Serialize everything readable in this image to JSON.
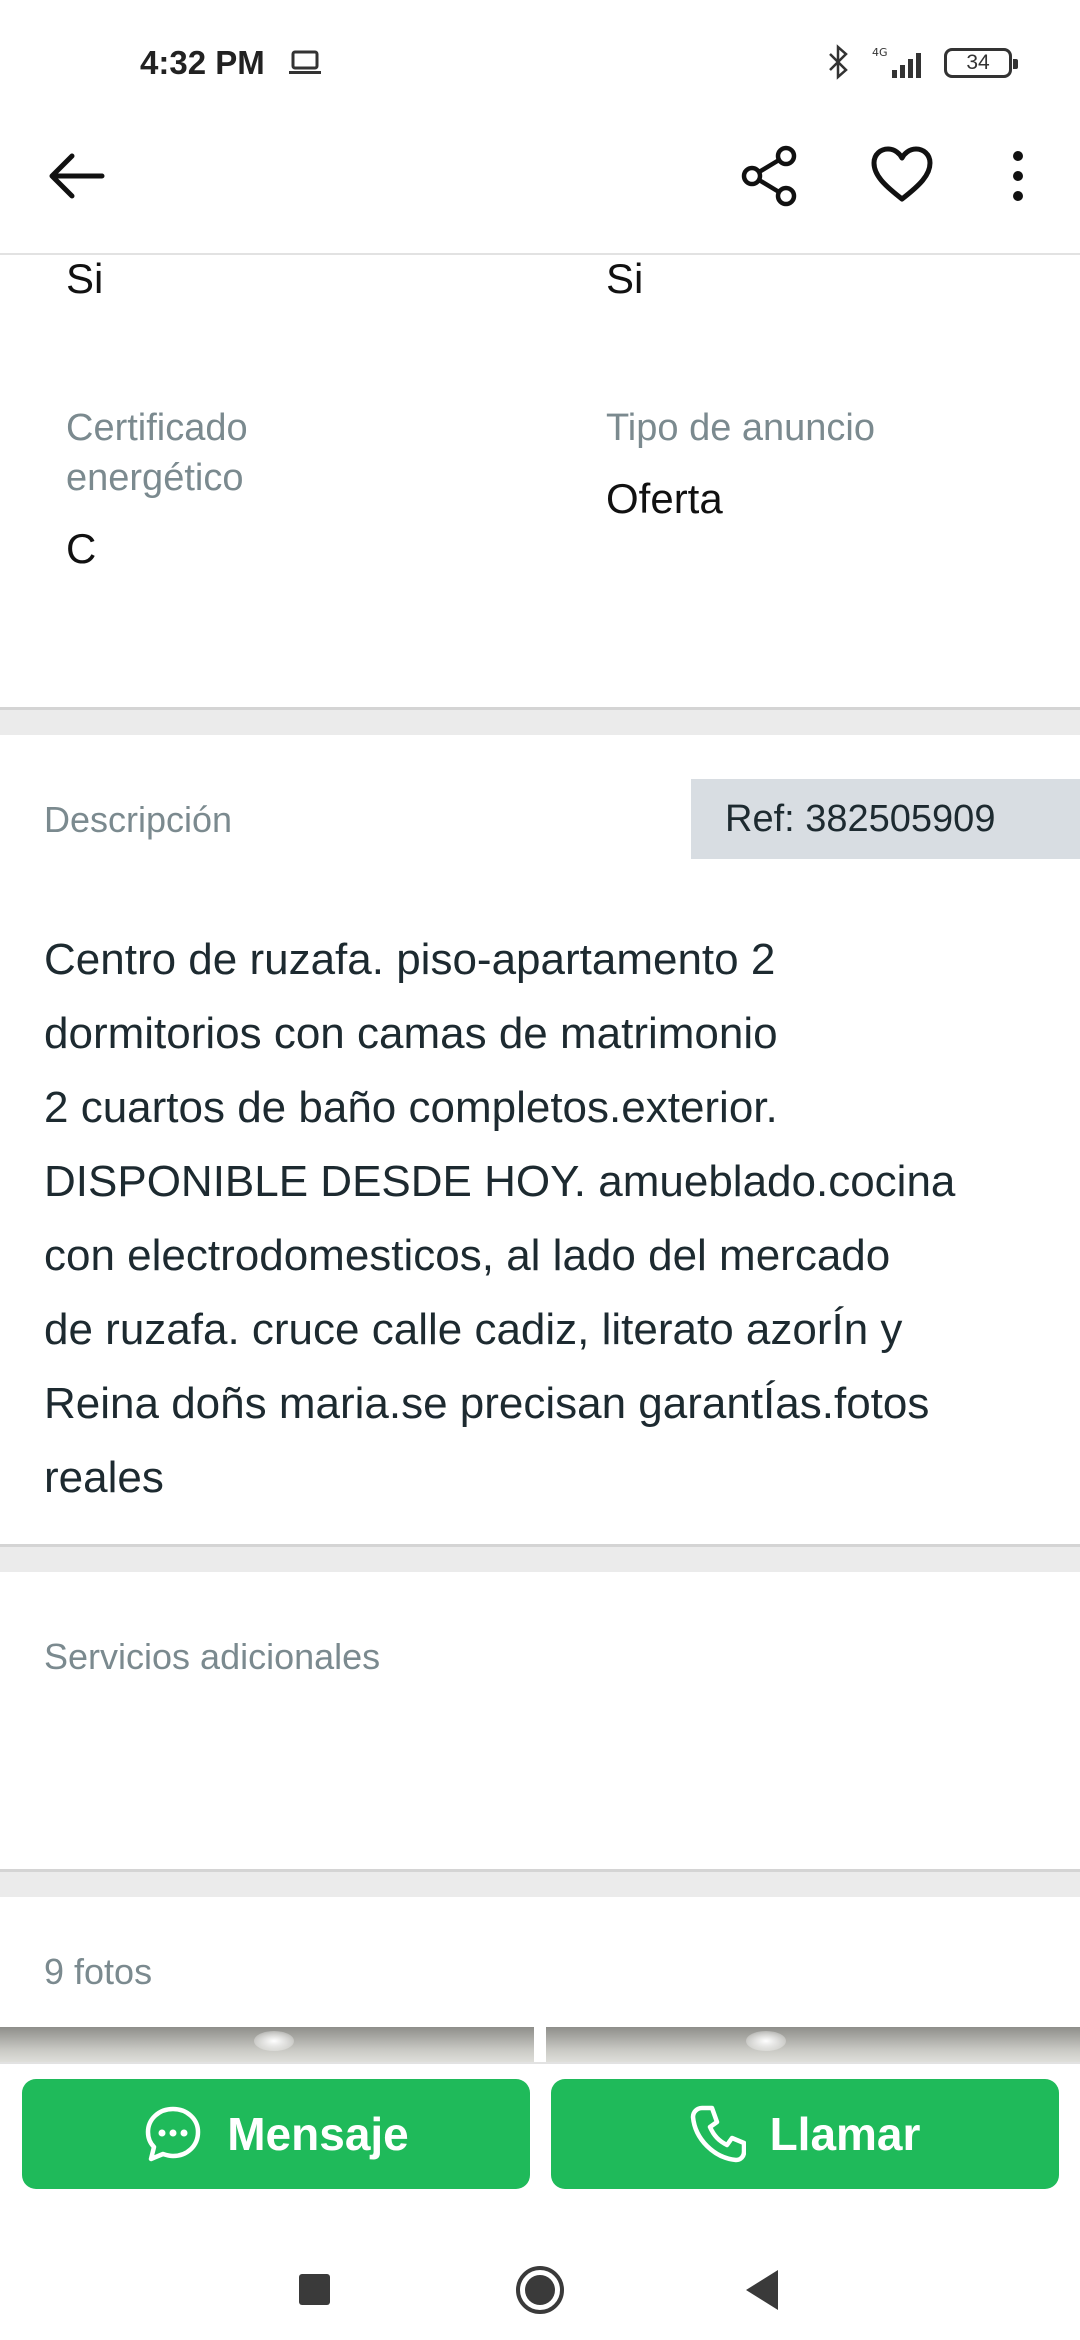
{
  "status_bar": {
    "time": "4:32 PM",
    "battery": "34",
    "network": "4G"
  },
  "app_bar": {
    "icons": [
      "back-arrow-icon",
      "share-icon",
      "heart-icon",
      "more-vertical-icon"
    ]
  },
  "details": {
    "top_left_value": "Si",
    "top_right_value": "Si",
    "energy_label": "Certificado\nenergético",
    "energy_value": "C",
    "ad_type_label": "Tipo de anuncio",
    "ad_type_value": "Oferta"
  },
  "description": {
    "title": "Descripción",
    "ref": "Ref: 382505909",
    "text": "Centro de ruzafa. piso-apartamento 2\ndormitorios con camas de matrimonio\n2 cuartos de baño completos.exterior.\nDISPONIBLE DESDE HOY. amueblado.cocina\ncon electrodomesticos, al lado del mercado\nde ruzafa. cruce calle cadiz, literato azorÍn y\nReina doñs maria.se precisan garantÍas.fotos\nreales"
  },
  "services": {
    "title": "Servicios adicionales"
  },
  "photos": {
    "title": "9 fotos"
  },
  "actions": {
    "message_label": "Mensaje",
    "call_label": "Llamar",
    "accent_color": "#1fba5a"
  }
}
